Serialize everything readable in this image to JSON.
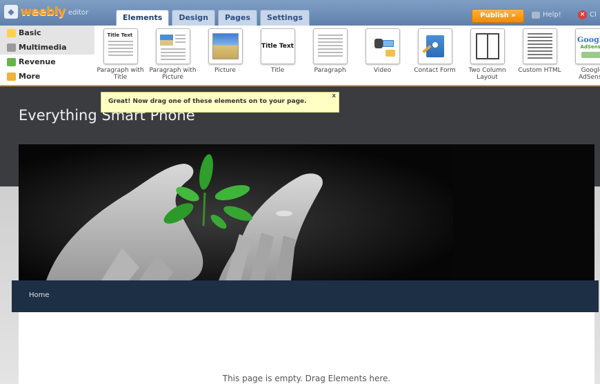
{
  "app": {
    "logo": "weebly",
    "logo_sub": "editor"
  },
  "tabs": [
    {
      "label": "Elements",
      "active": true
    },
    {
      "label": "Design",
      "active": false
    },
    {
      "label": "Pages",
      "active": false
    },
    {
      "label": "Settings",
      "active": false
    }
  ],
  "actions": {
    "publish": "Publish »",
    "help": "Help!",
    "close": "Cl"
  },
  "categories": [
    {
      "label": "Basic",
      "icon": "page-icon",
      "color": "#ffd24a"
    },
    {
      "label": "Multimedia",
      "icon": "film-icon",
      "color": "#9a9a9a"
    },
    {
      "label": "Revenue",
      "icon": "money-icon",
      "color": "#67b34a"
    },
    {
      "label": "More",
      "icon": "arrow-icon",
      "color": "#f0b23a"
    }
  ],
  "elements": [
    {
      "label": "Paragraph with Title",
      "icon": "paragraph-title-icon",
      "thumb_title": "Title Text"
    },
    {
      "label": "Paragraph with Picture",
      "icon": "paragraph-picture-icon"
    },
    {
      "label": "Picture",
      "icon": "picture-icon"
    },
    {
      "label": "Title",
      "icon": "title-icon",
      "thumb_title": "Title Text"
    },
    {
      "label": "Paragraph",
      "icon": "paragraph-icon"
    },
    {
      "label": "Video",
      "icon": "video-icon"
    },
    {
      "label": "Contact Form",
      "icon": "contact-form-icon"
    },
    {
      "label": "Two Column Layout",
      "icon": "two-column-icon"
    },
    {
      "label": "Custom HTML",
      "icon": "custom-html-icon"
    },
    {
      "label": "Google AdSense",
      "icon": "google-adsense-icon",
      "thumb_title": "Google",
      "thumb_sub": "AdSense"
    }
  ],
  "tooltip": {
    "text": "Great! Now drag one of these elements on to your page.",
    "close": "x"
  },
  "site": {
    "title": "Everything Smart Phone",
    "nav_home": "Home",
    "empty_message": "This page is empty. Drag Elements here."
  },
  "colors": {
    "accent": "#f28a00",
    "topbar": "#6f90b8",
    "nav": "#1d2f44"
  }
}
